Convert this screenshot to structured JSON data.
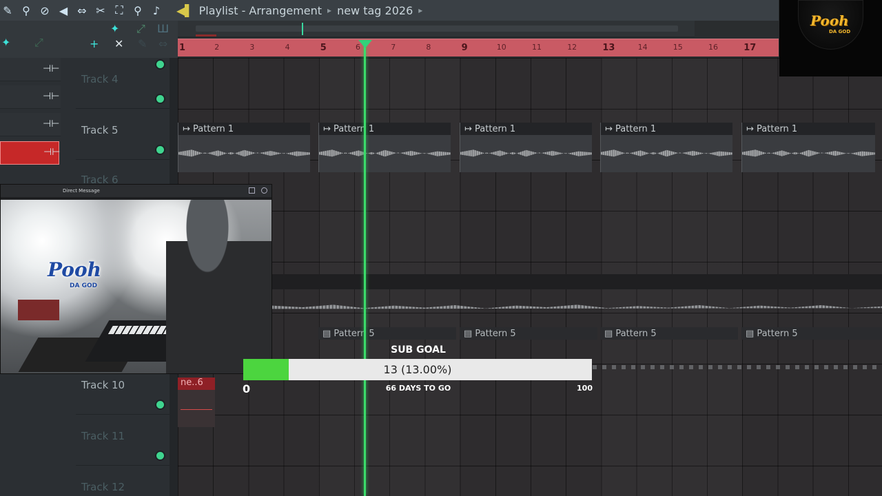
{
  "toolbar": {
    "title": "Playlist - Arrangement",
    "breadcrumb": "new tag 2026"
  },
  "ruler": {
    "bars": [
      "1",
      "2",
      "3",
      "4",
      "5",
      "6",
      "7",
      "8",
      "9",
      "10",
      "11",
      "12",
      "13",
      "14",
      "15",
      "16",
      "17"
    ],
    "major": [
      "1",
      "5",
      "9",
      "13",
      "17"
    ]
  },
  "tracks": [
    {
      "name": "Track 4",
      "dim": true
    },
    {
      "name": "Track 5",
      "dim": false
    },
    {
      "name": "Track 6",
      "dim": true
    },
    {
      "name": "Track 10",
      "dim": false
    },
    {
      "name": "Track 11",
      "dim": true
    },
    {
      "name": "Track 12",
      "dim": true
    }
  ],
  "clips": {
    "track5": [
      "Pattern 1",
      "Pattern 1",
      "Pattern 1",
      "Pattern 1",
      "Pattern 1"
    ],
    "pattern5": [
      "Pattern 5",
      "Pattern 5",
      "Pattern 5",
      "Pattern 5"
    ],
    "track10": "ne..6"
  },
  "webcam": {
    "title": "Direct Message",
    "logo": "Pooh",
    "logo_sub": "DA GOD"
  },
  "goal": {
    "title": "SUB GOAL",
    "value_text": "13 (13.00%)",
    "progress": 0.13,
    "min": "0",
    "max": "100",
    "days": "66 DAYS TO GO"
  },
  "logo": {
    "text": "Pooh",
    "sub": "DA GOD"
  },
  "colors": {
    "ruler": "#c95a64",
    "playhead": "#3bdc6a",
    "goal_fill": "#4cd53f"
  }
}
